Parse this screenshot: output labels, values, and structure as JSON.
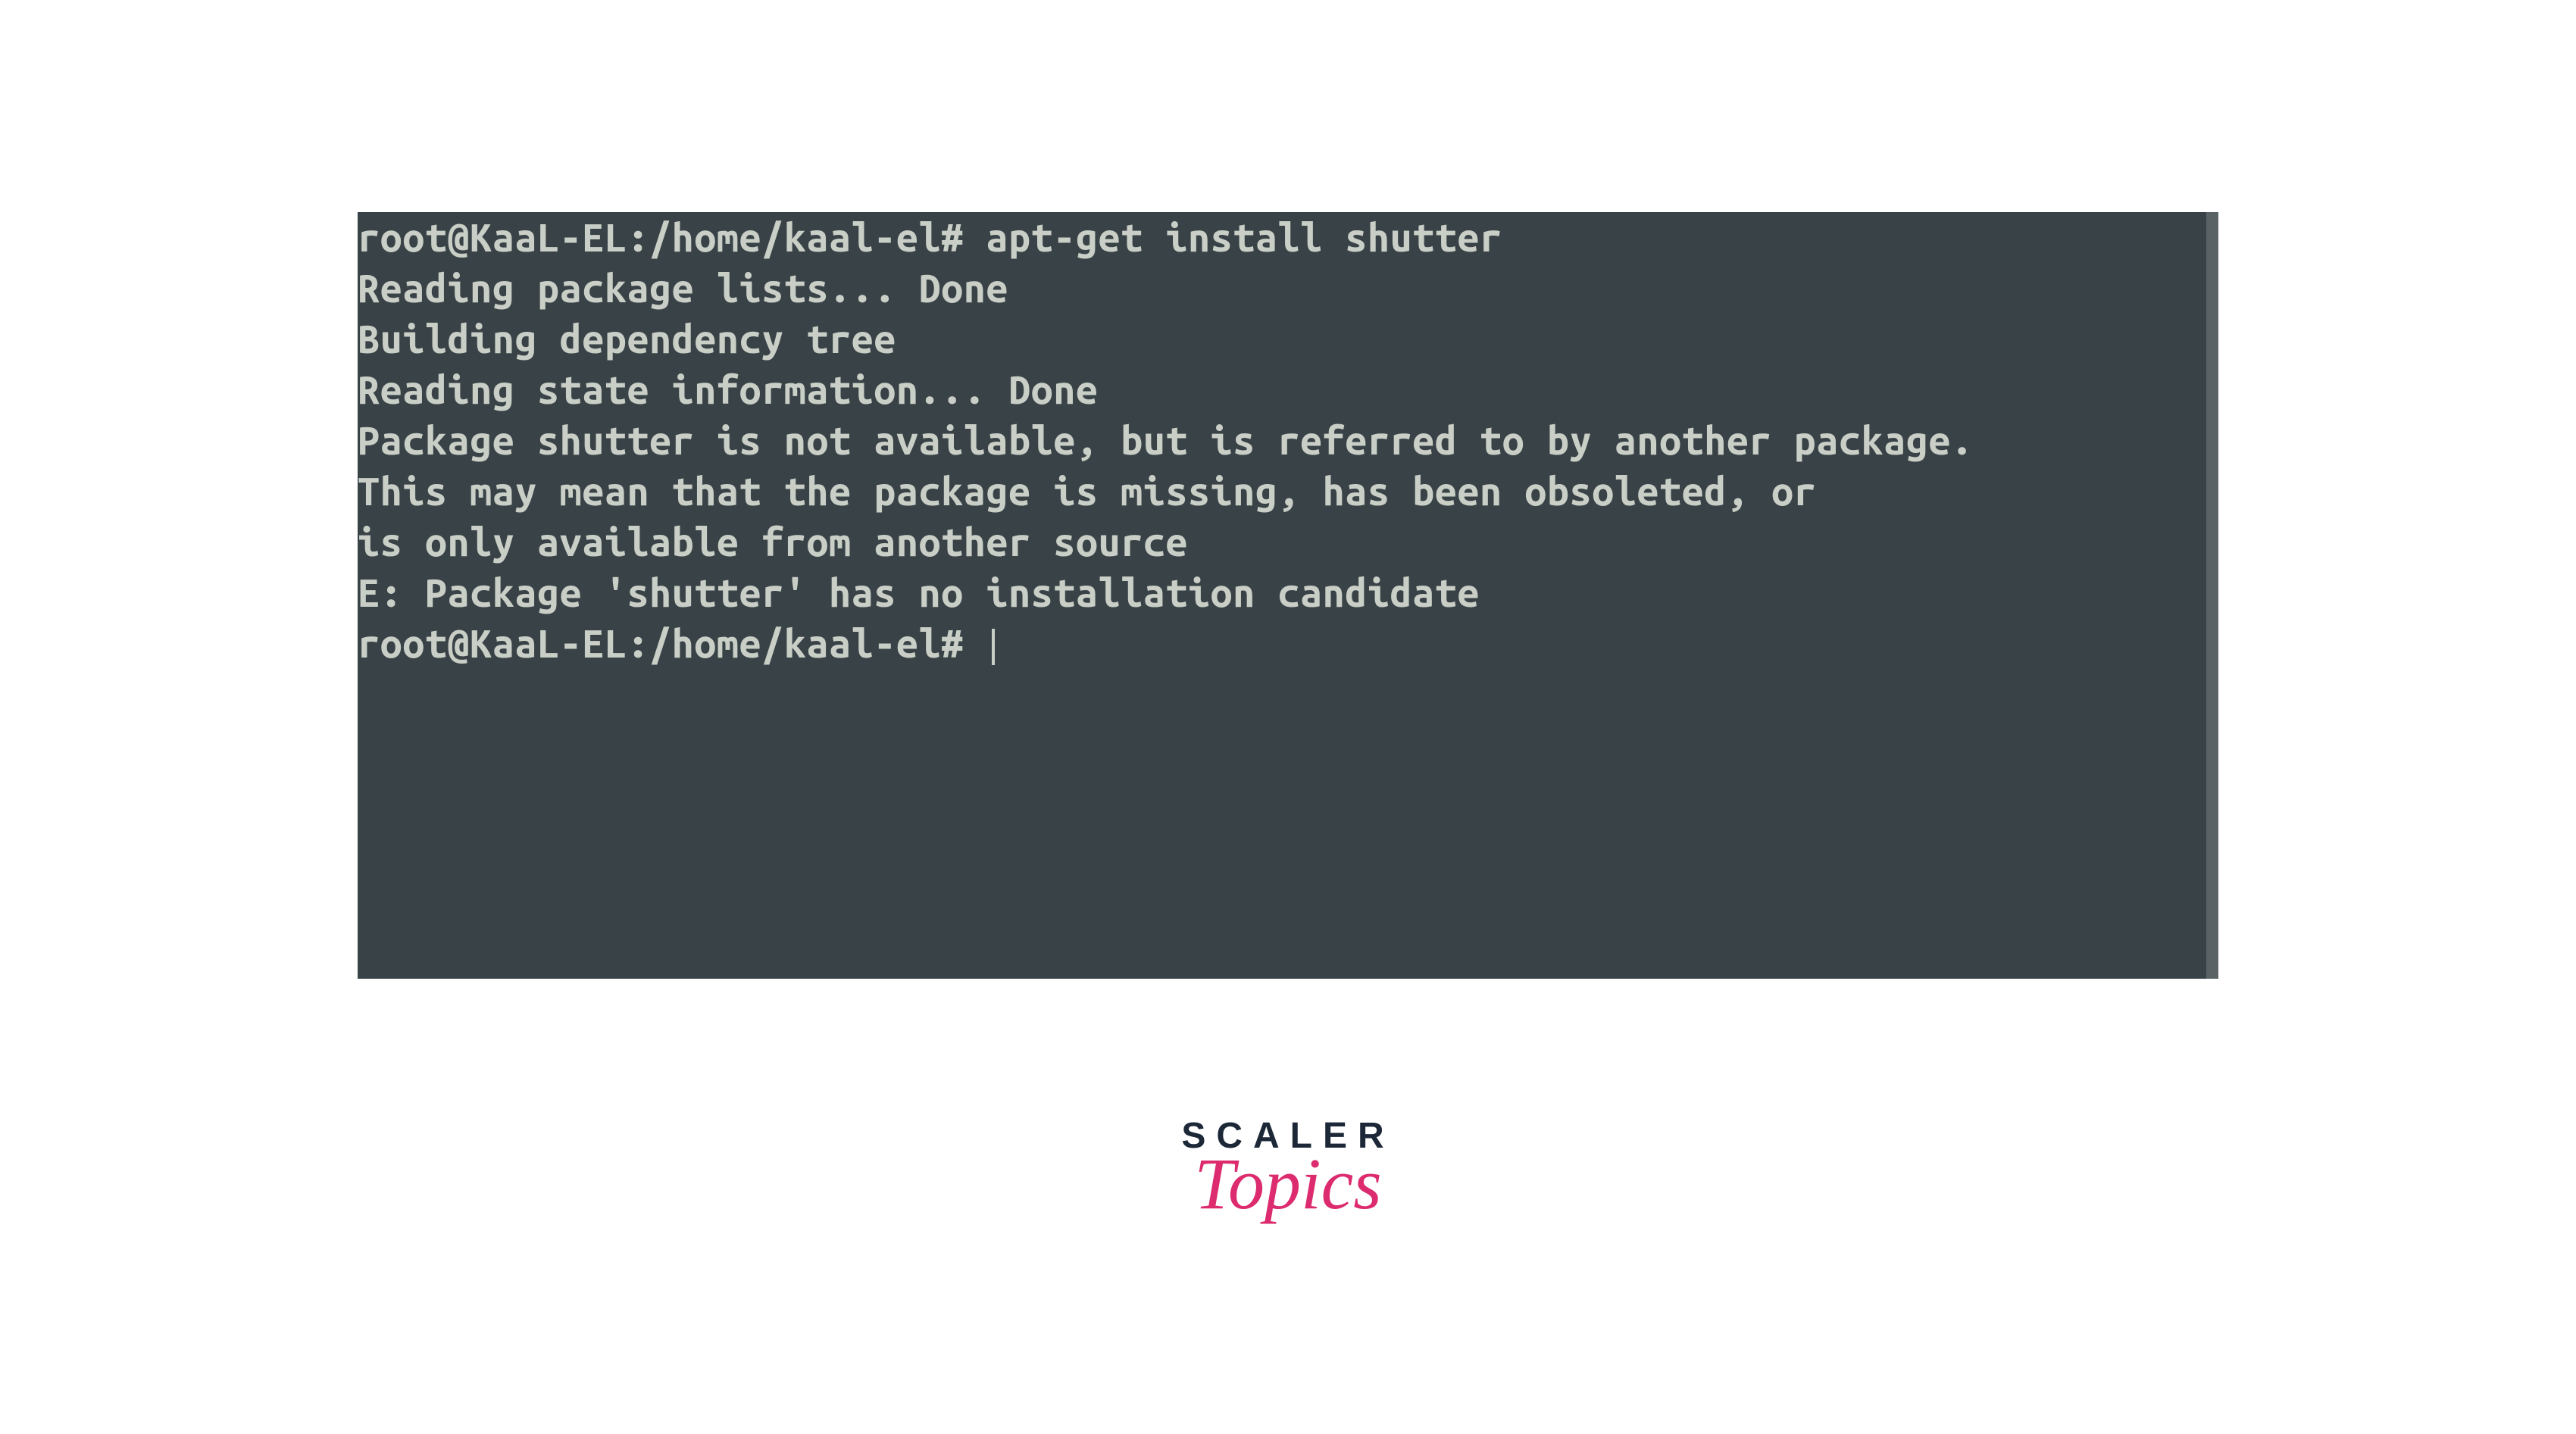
{
  "terminal": {
    "prompt": "root@KaaL-EL:/home/kaal-el# ",
    "command": "apt-get install shutter",
    "output_lines": [
      "Reading package lists... Done",
      "Building dependency tree",
      "Reading state information... Done",
      "Package shutter is not available, but is referred to by another package.",
      "This may mean that the package is missing, has been obsoleted, or",
      "is only available from another source",
      "",
      "E: Package 'shutter' has no installation candidate"
    ],
    "trailing_prompt": "root@KaaL-EL:/home/kaal-el# "
  },
  "logo": {
    "line1": "SCALER",
    "line2": "Topics"
  },
  "colors": {
    "terminal_bg": "#394247",
    "terminal_fg": "#c9cfc6",
    "scrollbar": "#5a6266",
    "logo_dark": "#1c2837",
    "logo_pink": "#dc2b6e"
  }
}
